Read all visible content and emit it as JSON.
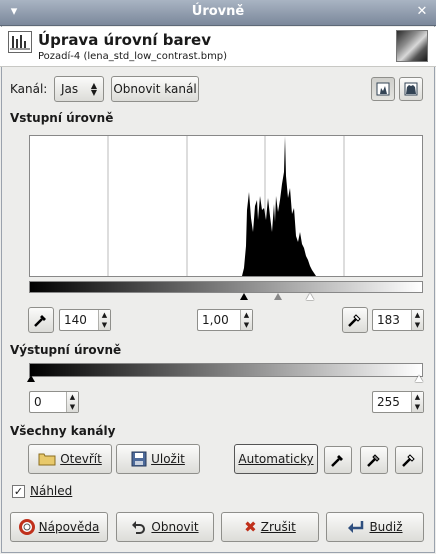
{
  "window": {
    "title": "Úrovně"
  },
  "header": {
    "title": "Úprava úrovní barev",
    "subtitle": "Pozadí-4 (lena_std_low_contrast.bmp)"
  },
  "channel": {
    "label": "Kanál:",
    "value": "Jas",
    "reset_label": "Obnovit kanál"
  },
  "input_levels": {
    "heading": "Vstupní úrovně",
    "low": "140",
    "gamma": "1,00",
    "high": "183"
  },
  "output_levels": {
    "heading": "Výstupní úrovně",
    "low": "0",
    "high": "255"
  },
  "all_channels": {
    "heading": "Všechny kanály",
    "open_label": "Otevřít",
    "save_label": "Uložit",
    "auto_label": "Automaticky"
  },
  "preview": {
    "label": "Náhled",
    "checked": true
  },
  "footer": {
    "help_label": "Nápověda",
    "reset_label": "Obnovit",
    "cancel_label": "Zrušit",
    "ok_label": "Budiž"
  },
  "histogram": {
    "min": 140,
    "max": 183,
    "gamma": 1.0
  }
}
